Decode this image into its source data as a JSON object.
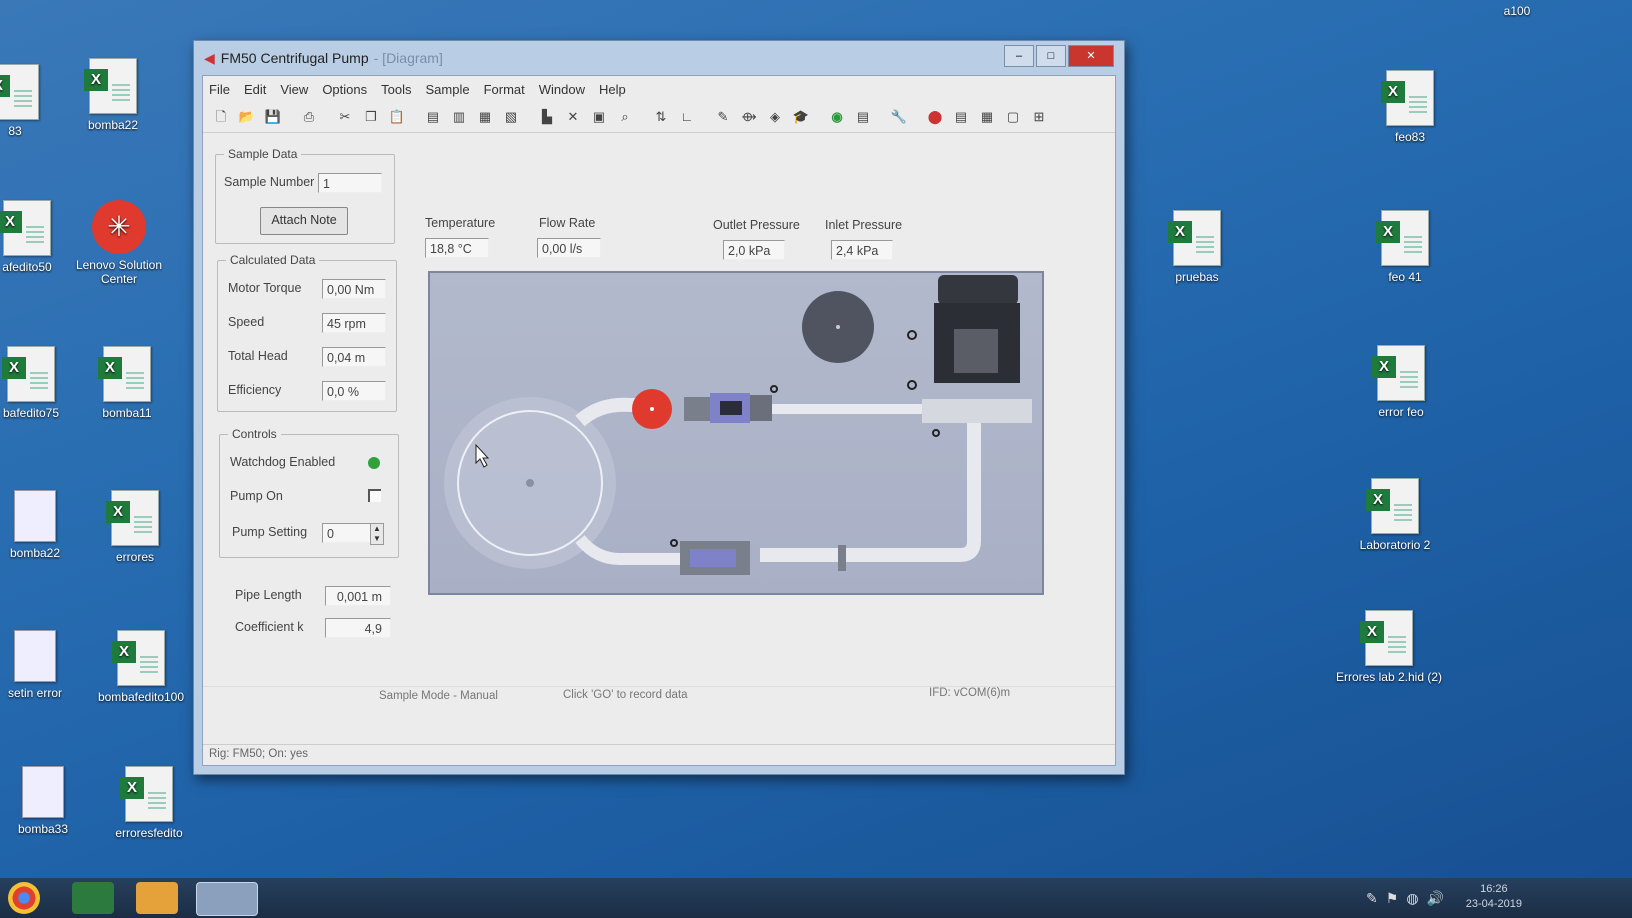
{
  "desktop": {
    "icons_left": [
      {
        "label": "83"
      },
      {
        "label": "bomba22"
      },
      {
        "label": "afedito50"
      },
      {
        "label": "Lenovo Solution Center"
      },
      {
        "label": "bafedito75"
      },
      {
        "label": "bomba11"
      },
      {
        "label": "bomba22"
      },
      {
        "label": "errores"
      },
      {
        "label": "setin error"
      },
      {
        "label": "bombafedito100"
      },
      {
        "label": "bomba33"
      },
      {
        "label": "erroresfedito"
      }
    ],
    "icons_right": [
      {
        "label": "feo83"
      },
      {
        "label": "pruebas"
      },
      {
        "label": "feo 41"
      },
      {
        "label": "error feo"
      },
      {
        "label": "Laboratorio 2"
      },
      {
        "label": "Errores lab 2.hid (2)"
      },
      {
        "label": "a100"
      }
    ]
  },
  "window": {
    "title": "FM50 Centrifugal Pump",
    "title_suffix": "- [Diagram]",
    "controls": {
      "minimize": "–",
      "maximize": "□",
      "close": "✕"
    }
  },
  "menu": [
    "File",
    "Edit",
    "View",
    "Options",
    "Tools",
    "Sample",
    "Format",
    "Window",
    "Help"
  ],
  "sample_data": {
    "group_label": "Sample Data",
    "sample_number_label": "Sample Number",
    "sample_number_value": "1",
    "attach_note": "Attach Note"
  },
  "calculated": {
    "group_label": "Calculated Data",
    "rows": [
      {
        "label": "Motor Torque",
        "value": "0,00 Nm"
      },
      {
        "label": "Speed",
        "value": "45 rpm"
      },
      {
        "label": "Total Head",
        "value": "0,04 m"
      },
      {
        "label": "Efficiency",
        "value": "0,0 %"
      }
    ]
  },
  "controls": {
    "group_label": "Controls",
    "watchdog_label": "Watchdog Enabled",
    "pump_on_label": "Pump On",
    "pump_setting_label": "Pump Setting",
    "pump_setting_value": "0"
  },
  "params": {
    "pipe_length_label": "Pipe Length",
    "pipe_length_value": "0,001 m",
    "coefficient_label": "Coefficient k",
    "coefficient_value": "4,9"
  },
  "readouts": [
    {
      "label": "Temperature",
      "value": "18,8 °C"
    },
    {
      "label": "Flow Rate",
      "value": "0,00 l/s"
    },
    {
      "label": "Outlet Pressure",
      "value": "2,0 kPa"
    },
    {
      "label": "Inlet Pressure",
      "value": "2,4 kPa"
    }
  ],
  "status": {
    "mode": "Sample Mode - Manual",
    "hint": "Click 'GO' to record data",
    "ifd": "IFD: vCOM(6)m",
    "rig": "Rig: FM50; On: yes"
  },
  "taskbar": {
    "time": "16:26",
    "date": "23-04-2019"
  },
  "colors": {
    "accent_red": "#e03a2e",
    "watchdog_green": "#2fa33a"
  }
}
